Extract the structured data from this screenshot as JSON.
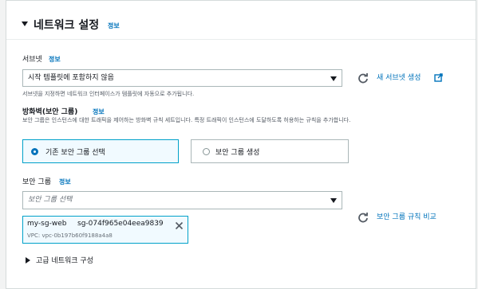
{
  "section": {
    "title": "네트워크 설정",
    "info": "정보"
  },
  "subnet": {
    "label": "서브넷",
    "info": "정보",
    "value": "시작 템플릿에 포함하지 않음",
    "help": "서브넷을 지정하면 네트워크 인터페이스가 템플릿에 자동으로 추가됩니다.",
    "create_link": "새 서브넷 생성"
  },
  "firewall": {
    "label": "방화벽(보안 그룹)",
    "info": "정보",
    "description": "보안 그룹은 인스턴스에 대한 트래픽을 제어하는 방화벽 규칙 세트입니다. 특정 트래픽이 인스턴스에 도달하도록 허용하는 규칙을 추가합니다.",
    "options": [
      {
        "label": "기존 보안 그룹 선택",
        "selected": true
      },
      {
        "label": "보안 그룹 생성",
        "selected": false
      }
    ]
  },
  "security_group": {
    "label": "보안 그룹",
    "info": "정보",
    "placeholder": "보안 그룹 선택",
    "token_name": "my-sg-web",
    "token_id": "sg-074f965e04eea9839",
    "token_vpc": "VPC: vpc-0b197b60f9188a4a8",
    "compare_link": "보안 그룹 규칙 비교"
  },
  "advanced": {
    "label": "고급 네트워크 구성"
  },
  "colors": {
    "link": "#0073bb",
    "selected_border": "#00a1c9",
    "selected_bg": "#f1faff"
  },
  "icons": [
    "caret-down-icon",
    "refresh-icon",
    "external-link-icon",
    "close-icon",
    "caret-right-icon"
  ]
}
